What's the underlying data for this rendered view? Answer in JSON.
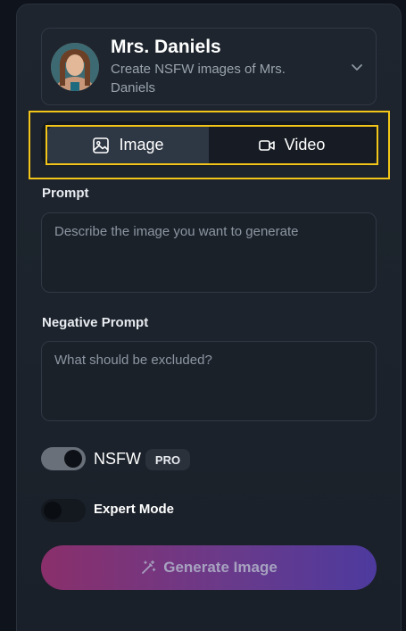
{
  "character": {
    "name": "Mrs. Daniels",
    "description": "Create NSFW images of Mrs. Daniels"
  },
  "tabs": [
    {
      "label": "Image",
      "icon": "image-icon",
      "active": true
    },
    {
      "label": "Video",
      "icon": "video-icon",
      "active": false
    }
  ],
  "prompt": {
    "label": "Prompt",
    "placeholder": "Describe the image you want to generate",
    "value": ""
  },
  "negative_prompt": {
    "label": "Negative Prompt",
    "placeholder": "What should be excluded?",
    "value": ""
  },
  "nsfw": {
    "label": "NSFW",
    "badge": "PRO",
    "enabled": true
  },
  "expert_mode": {
    "label": "Expert Mode",
    "enabled": false
  },
  "generate_button": {
    "label": "Generate Image",
    "icon": "magic-wand-icon"
  },
  "colors": {
    "highlight": "#f2c518",
    "button_gradient_start": "#8a2f6b",
    "button_gradient_end": "#4d3a9e"
  }
}
